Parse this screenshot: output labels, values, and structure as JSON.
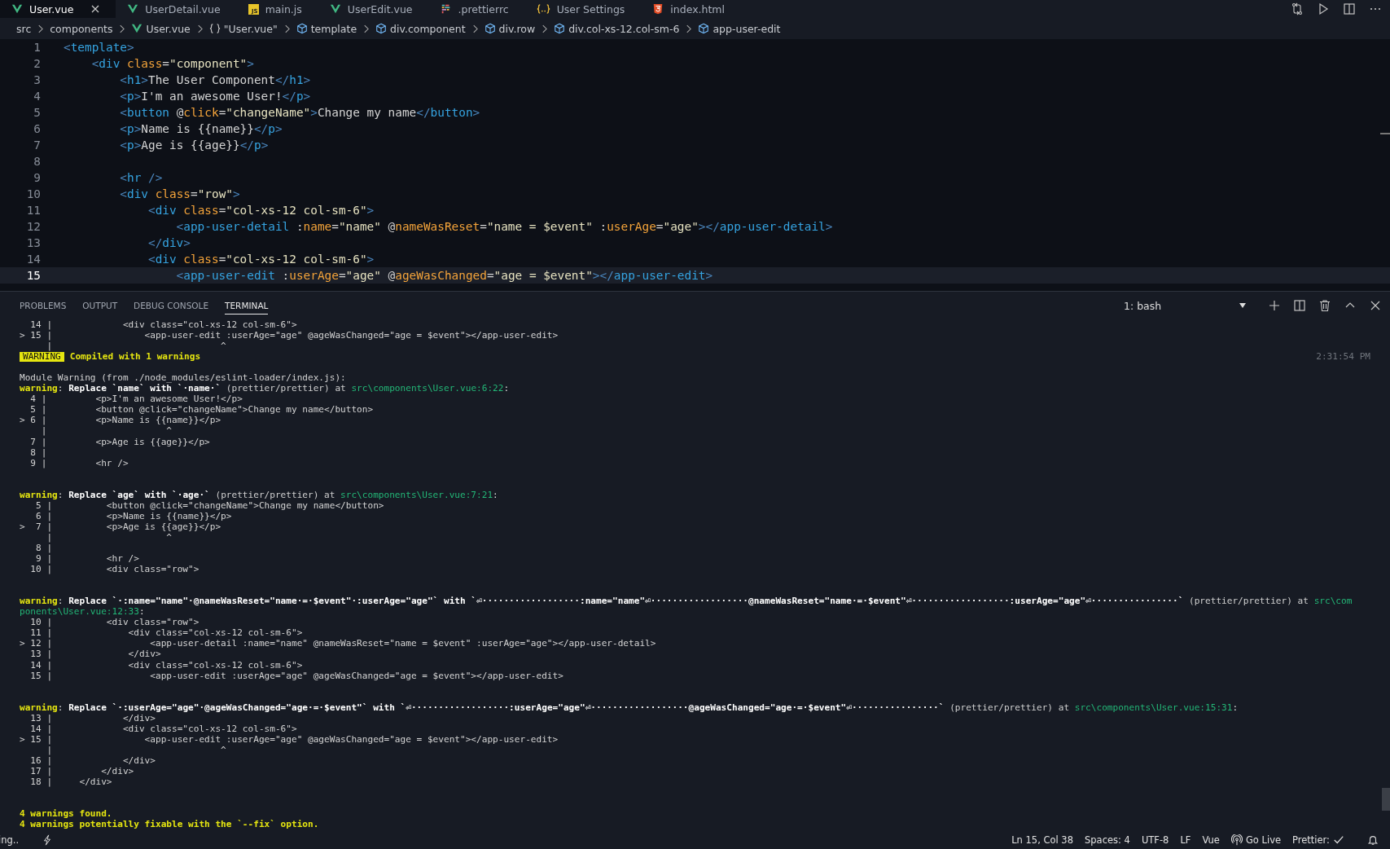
{
  "tabs": [
    {
      "label": "User.vue",
      "kind": "vue",
      "selected": true
    },
    {
      "label": "UserDetail.vue",
      "kind": "vue",
      "selected": false
    },
    {
      "label": "main.js",
      "kind": "js",
      "icon_text": "JS",
      "selected": false
    },
    {
      "label": "UserEdit.vue",
      "kind": "vue",
      "selected": false
    },
    {
      "label": ".prettierrc",
      "kind": "prettier",
      "selected": false
    },
    {
      "label": "User Settings",
      "kind": "settings",
      "selected": false
    },
    {
      "label": "index.html",
      "kind": "html",
      "selected": false
    }
  ],
  "breadcrumb": [
    {
      "label": "src",
      "kind": "folder"
    },
    {
      "label": "components",
      "kind": "folder"
    },
    {
      "label": "User.vue",
      "kind": "vue"
    },
    {
      "label": "\"User.vue\"",
      "kind": "module"
    },
    {
      "label": "template",
      "kind": "element"
    },
    {
      "label": "div.component",
      "kind": "element"
    },
    {
      "label": "div.row",
      "kind": "element"
    },
    {
      "label": "div.col-xs-12.col-sm-6",
      "kind": "element"
    },
    {
      "label": "app-user-edit",
      "kind": "element"
    }
  ],
  "editor": {
    "lines": [
      {
        "number": "1",
        "current": false,
        "tokens": [
          {
            "kind": "punct",
            "text": "<"
          },
          {
            "kind": "tag",
            "text": "template"
          },
          {
            "kind": "punct",
            "text": ">"
          }
        ]
      },
      {
        "number": "2",
        "current": false,
        "tokens": [
          {
            "kind": "punct",
            "text": "    <"
          },
          {
            "kind": "tag",
            "text": "div"
          },
          {
            "kind": "attr",
            "text": " class"
          },
          {
            "kind": "text",
            "text": "="
          },
          {
            "kind": "str",
            "text": "\"component\""
          },
          {
            "kind": "punct",
            "text": ">"
          }
        ]
      },
      {
        "number": "3",
        "current": false,
        "tokens": [
          {
            "kind": "punct",
            "text": "        <"
          },
          {
            "kind": "tag",
            "text": "h1"
          },
          {
            "kind": "punct",
            "text": ">"
          },
          {
            "kind": "text",
            "text": "The User Component"
          },
          {
            "kind": "punct",
            "text": "</"
          },
          {
            "kind": "tag",
            "text": "h1"
          },
          {
            "kind": "punct",
            "text": ">"
          }
        ]
      },
      {
        "number": "4",
        "current": false,
        "tokens": [
          {
            "kind": "punct",
            "text": "        <"
          },
          {
            "kind": "tag",
            "text": "p"
          },
          {
            "kind": "punct",
            "text": ">"
          },
          {
            "kind": "text",
            "text": "I'm an awesome User!"
          },
          {
            "kind": "punct",
            "text": "</"
          },
          {
            "kind": "tag",
            "text": "p"
          },
          {
            "kind": "punct",
            "text": ">"
          }
        ]
      },
      {
        "number": "5",
        "current": false,
        "tokens": [
          {
            "kind": "punct",
            "text": "        <"
          },
          {
            "kind": "tag",
            "text": "button"
          },
          {
            "kind": "text",
            "text": " @"
          },
          {
            "kind": "attr",
            "text": "click"
          },
          {
            "kind": "text",
            "text": "="
          },
          {
            "kind": "str",
            "text": "\"changeName\""
          },
          {
            "kind": "punct",
            "text": ">"
          },
          {
            "kind": "text",
            "text": "Change my name"
          },
          {
            "kind": "punct",
            "text": "</"
          },
          {
            "kind": "tag",
            "text": "button"
          },
          {
            "kind": "punct",
            "text": ">"
          }
        ]
      },
      {
        "number": "6",
        "current": false,
        "tokens": [
          {
            "kind": "punct",
            "text": "        <"
          },
          {
            "kind": "tag",
            "text": "p"
          },
          {
            "kind": "punct",
            "text": ">"
          },
          {
            "kind": "text",
            "text": "Name is {{name}}"
          },
          {
            "kind": "punct",
            "text": "</"
          },
          {
            "kind": "tag",
            "text": "p"
          },
          {
            "kind": "punct",
            "text": ">"
          }
        ]
      },
      {
        "number": "7",
        "current": false,
        "tokens": [
          {
            "kind": "punct",
            "text": "        <"
          },
          {
            "kind": "tag",
            "text": "p"
          },
          {
            "kind": "punct",
            "text": ">"
          },
          {
            "kind": "text",
            "text": "Age is {{age}}"
          },
          {
            "kind": "punct",
            "text": "</"
          },
          {
            "kind": "tag",
            "text": "p"
          },
          {
            "kind": "punct",
            "text": ">"
          }
        ]
      },
      {
        "number": "8",
        "current": false
      },
      {
        "number": "9",
        "current": false,
        "tokens": [
          {
            "kind": "punct",
            "text": "        <"
          },
          {
            "kind": "tag",
            "text": "hr"
          },
          {
            "kind": "punct",
            "text": " />"
          }
        ]
      },
      {
        "number": "10",
        "current": false,
        "tokens": [
          {
            "kind": "punct",
            "text": "        <"
          },
          {
            "kind": "tag",
            "text": "div"
          },
          {
            "kind": "attr",
            "text": " class"
          },
          {
            "kind": "text",
            "text": "="
          },
          {
            "kind": "str",
            "text": "\"row\""
          },
          {
            "kind": "punct",
            "text": ">"
          }
        ]
      },
      {
        "number": "11",
        "current": false,
        "tokens": [
          {
            "kind": "punct",
            "text": "            <"
          },
          {
            "kind": "tag",
            "text": "div"
          },
          {
            "kind": "attr",
            "text": " class"
          },
          {
            "kind": "text",
            "text": "="
          },
          {
            "kind": "str",
            "text": "\"col-xs-12 col-sm-6\""
          },
          {
            "kind": "punct",
            "text": ">"
          }
        ]
      },
      {
        "number": "12",
        "current": false,
        "tokens": [
          {
            "kind": "punct",
            "text": "                <"
          },
          {
            "kind": "tag",
            "text": "app-user-detail"
          },
          {
            "kind": "text",
            "text": " :"
          },
          {
            "kind": "attr",
            "text": "name"
          },
          {
            "kind": "text",
            "text": "="
          },
          {
            "kind": "str",
            "text": "\"name\""
          },
          {
            "kind": "text",
            "text": " @"
          },
          {
            "kind": "attr",
            "text": "nameWasReset"
          },
          {
            "kind": "text",
            "text": "="
          },
          {
            "kind": "str",
            "text": "\"name = $event\""
          },
          {
            "kind": "text",
            "text": " :"
          },
          {
            "kind": "attr",
            "text": "userAge"
          },
          {
            "kind": "text",
            "text": "="
          },
          {
            "kind": "str",
            "text": "\"age\""
          },
          {
            "kind": "punct",
            "text": "></"
          },
          {
            "kind": "tag",
            "text": "app-user-detail"
          },
          {
            "kind": "punct",
            "text": ">"
          }
        ]
      },
      {
        "number": "13",
        "current": false,
        "tokens": [
          {
            "kind": "punct",
            "text": "            </"
          },
          {
            "kind": "tag",
            "text": "div"
          },
          {
            "kind": "punct",
            "text": ">"
          }
        ]
      },
      {
        "number": "14",
        "current": false,
        "tokens": [
          {
            "kind": "punct",
            "text": "            <"
          },
          {
            "kind": "tag",
            "text": "div"
          },
          {
            "kind": "attr",
            "text": " class"
          },
          {
            "kind": "text",
            "text": "="
          },
          {
            "kind": "str",
            "text": "\"col-xs-12 col-sm-6\""
          },
          {
            "kind": "punct",
            "text": ">"
          }
        ]
      },
      {
        "number": "15",
        "current": true,
        "tokens": [
          {
            "kind": "punct",
            "text": "                <"
          },
          {
            "kind": "tag",
            "text": "app-user-edit"
          },
          {
            "kind": "text",
            "text": " :"
          },
          {
            "kind": "attr",
            "text": "userAge"
          },
          {
            "kind": "text",
            "text": "="
          },
          {
            "kind": "str",
            "text": "\"age\""
          },
          {
            "kind": "text",
            "text": " @"
          },
          {
            "kind": "attr",
            "text": "ageWasChanged"
          },
          {
            "kind": "text",
            "text": "="
          },
          {
            "kind": "str",
            "text": "\"age = $event\""
          },
          {
            "kind": "punct",
            "text": "></"
          },
          {
            "kind": "tag",
            "text": "app-user-edit"
          },
          {
            "kind": "punct",
            "text": ">"
          }
        ]
      }
    ]
  },
  "panel": {
    "tabs": [
      {
        "label": "PROBLEMS",
        "selected": false
      },
      {
        "label": "OUTPUT",
        "selected": false
      },
      {
        "label": "DEBUG CONSOLE",
        "selected": false
      },
      {
        "label": "TERMINAL",
        "selected": true
      }
    ],
    "terminal_select": "1: bash",
    "lines": [
      {
        "kind": "plain",
        "text": "  14 |             <div class=\"col-xs-12 col-sm-6\">"
      },
      {
        "kind": "plain",
        "text": "> 15 |                 <app-user-edit :userAge=\"age\" @ageWasChanged=\"age = $event\"></app-user-edit>"
      },
      {
        "kind": "plain",
        "text": "     |                               ^"
      },
      {
        "kind": "status",
        "badge": "WARNING",
        "text": "Compiled with 1 warnings",
        "time": "2:31:54 PM"
      },
      {
        "kind": "blank"
      },
      {
        "kind": "plain",
        "text": "Module Warning (from ./node_modules/eslint-loader/index.js):"
      },
      {
        "kind": "rich",
        "parts": [
          {
            "kind": "warn",
            "text": "warning"
          },
          {
            "kind": "plain",
            "text": ": "
          },
          {
            "kind": "bold",
            "text": "Replace `name` with `·name·`"
          },
          {
            "kind": "dim",
            "text": " (prettier/prettier) at "
          },
          {
            "kind": "path",
            "text": "src\\components\\User.vue:6:22"
          },
          {
            "kind": "plain",
            "text": ":"
          }
        ]
      },
      {
        "kind": "plain",
        "text": "  4 |         <p>I'm an awesome User!</p>"
      },
      {
        "kind": "plain",
        "text": "  5 |         <button @click=\"changeName\">Change my name</button>"
      },
      {
        "kind": "plain",
        "text": "> 6 |         <p>Name is {{name}}</p>"
      },
      {
        "kind": "plain",
        "text": "    |                      ^"
      },
      {
        "kind": "plain",
        "text": "  7 |         <p>Age is {{age}}</p>"
      },
      {
        "kind": "plain",
        "text": "  8 |"
      },
      {
        "kind": "plain",
        "text": "  9 |         <hr />"
      },
      {
        "kind": "blank"
      },
      {
        "kind": "blank"
      },
      {
        "kind": "rich",
        "parts": [
          {
            "kind": "warn",
            "text": "warning"
          },
          {
            "kind": "plain",
            "text": ": "
          },
          {
            "kind": "bold",
            "text": "Replace `age` with `·age·`"
          },
          {
            "kind": "dim",
            "text": " (prettier/prettier) at "
          },
          {
            "kind": "path",
            "text": "src\\components\\User.vue:7:21"
          },
          {
            "kind": "plain",
            "text": ":"
          }
        ]
      },
      {
        "kind": "plain",
        "text": "   5 |          <button @click=\"changeName\">Change my name</button>"
      },
      {
        "kind": "plain",
        "text": "   6 |          <p>Name is {{name}}</p>"
      },
      {
        "kind": "plain",
        "text": ">  7 |          <p>Age is {{age}}</p>"
      },
      {
        "kind": "plain",
        "text": "     |                     ^"
      },
      {
        "kind": "plain",
        "text": "   8 |"
      },
      {
        "kind": "plain",
        "text": "   9 |          <hr />"
      },
      {
        "kind": "plain",
        "text": "  10 |          <div class=\"row\">"
      },
      {
        "kind": "blank"
      },
      {
        "kind": "blank"
      },
      {
        "kind": "rich",
        "parts": [
          {
            "kind": "warn",
            "text": "warning"
          },
          {
            "kind": "plain",
            "text": ": "
          },
          {
            "kind": "bold",
            "text": "Replace `·:name=\"name\"·@nameWasReset=\"name·=·$event\"·:userAge=\"age\"` with `⏎··················:name=\"name\"⏎··················@nameWasReset=\"name·=·$event\"⏎··················:userAge=\"age\"⏎················`"
          },
          {
            "kind": "dim",
            "text": " (prettier/prettier) at "
          },
          {
            "kind": "path",
            "text": "src\\com"
          }
        ]
      },
      {
        "kind": "rich",
        "parts": [
          {
            "kind": "path",
            "text": "ponents\\User.vue:12:33"
          },
          {
            "kind": "plain",
            "text": ":"
          }
        ]
      },
      {
        "kind": "plain",
        "text": "  10 |          <div class=\"row\">"
      },
      {
        "kind": "plain",
        "text": "  11 |              <div class=\"col-xs-12 col-sm-6\">"
      },
      {
        "kind": "plain",
        "text": "> 12 |                  <app-user-detail :name=\"name\" @nameWasReset=\"name = $event\" :userAge=\"age\"></app-user-detail>"
      },
      {
        "kind": "plain",
        "text": "  13 |              </div>"
      },
      {
        "kind": "plain",
        "text": "  14 |              <div class=\"col-xs-12 col-sm-6\">"
      },
      {
        "kind": "plain",
        "text": "  15 |                  <app-user-edit :userAge=\"age\" @ageWasChanged=\"age = $event\"></app-user-edit>"
      },
      {
        "kind": "blank"
      },
      {
        "kind": "blank"
      },
      {
        "kind": "rich",
        "parts": [
          {
            "kind": "warn",
            "text": "warning"
          },
          {
            "kind": "plain",
            "text": ": "
          },
          {
            "kind": "bold",
            "text": "Replace `·:userAge=\"age\"·@ageWasChanged=\"age·=·$event\"` with `⏎··················:userAge=\"age\"⏎··················@ageWasChanged=\"age·=·$event\"⏎················`"
          },
          {
            "kind": "dim",
            "text": " (prettier/prettier) at "
          },
          {
            "kind": "path",
            "text": "src\\components\\User.vue:15:31"
          },
          {
            "kind": "plain",
            "text": ":"
          }
        ]
      },
      {
        "kind": "plain",
        "text": "  13 |             </div>"
      },
      {
        "kind": "plain",
        "text": "  14 |             <div class=\"col-xs-12 col-sm-6\">"
      },
      {
        "kind": "plain",
        "text": "> 15 |                 <app-user-edit :userAge=\"age\" @ageWasChanged=\"age = $event\"></app-user-edit>"
      },
      {
        "kind": "plain",
        "text": "     |                               ^"
      },
      {
        "kind": "plain",
        "text": "  16 |             </div>"
      },
      {
        "kind": "plain",
        "text": "  17 |         </div>"
      },
      {
        "kind": "plain",
        "text": "  18 |     </div>"
      },
      {
        "kind": "blank"
      },
      {
        "kind": "blank"
      },
      {
        "kind": "alert",
        "text": "4 warnings found."
      },
      {
        "kind": "alert",
        "text": "4 warnings potentially fixable with the `--fix` option."
      }
    ]
  },
  "status_bar": {
    "left_text": "ing..",
    "items": [
      {
        "kind": "text",
        "label": "Ln 15, Col 38"
      },
      {
        "kind": "text",
        "label": "Spaces: 4"
      },
      {
        "kind": "text",
        "label": "UTF-8"
      },
      {
        "kind": "text",
        "label": "LF"
      },
      {
        "kind": "text",
        "label": "Vue"
      },
      {
        "kind": "live",
        "label": "Go Live"
      },
      {
        "kind": "check",
        "label": "Prettier:"
      }
    ]
  }
}
